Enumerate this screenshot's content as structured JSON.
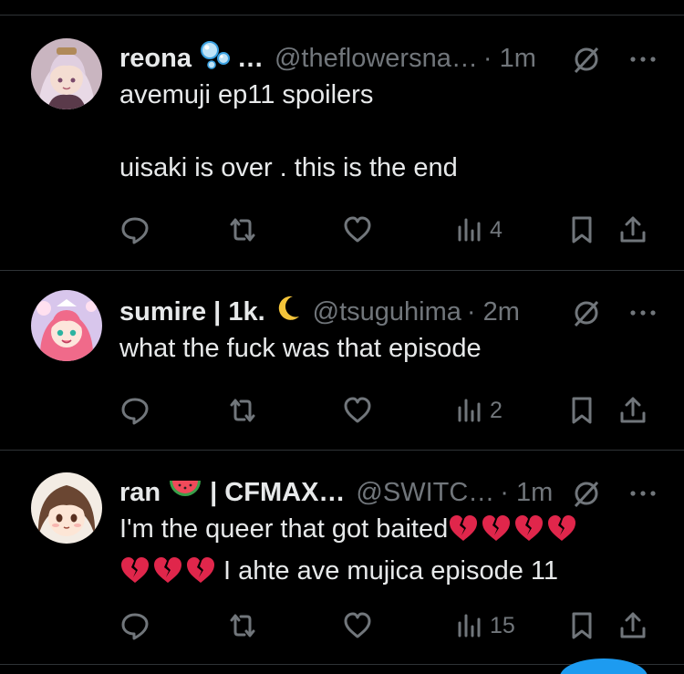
{
  "posts": [
    {
      "name": "reona",
      "name_suffix": "…",
      "handle": "@theflowersna…",
      "time": "· 1m",
      "lines": [
        "avemuji ep11 spoilers",
        "",
        "uisaki is over . this is the end"
      ],
      "views": "4",
      "name_emoji": "bubbles-icon"
    },
    {
      "name": "sumire | 1k.",
      "handle": "@tsuguhima",
      "time": "· 2m",
      "lines": [
        "what the fuck was that episode"
      ],
      "views": "2",
      "name_emoji": "crescent-moon-icon"
    },
    {
      "name": "ran",
      "name_after": "| CFMAX…",
      "handle": "@SWITC…",
      "time": "· 1m",
      "line1": "I'm the queer that got baited",
      "line2": "I ahte ave mujica episode 11",
      "views": "15",
      "name_emoji": "watermelon-icon",
      "broken_hearts_line1": 4,
      "broken_hearts_line2": 3
    }
  ],
  "colors": {
    "background": "#000000",
    "text": "#e7e9ea",
    "muted": "#71767b",
    "divider": "#2f3336",
    "broken_heart": "#e0264b",
    "accent": "#1d9bf0"
  }
}
